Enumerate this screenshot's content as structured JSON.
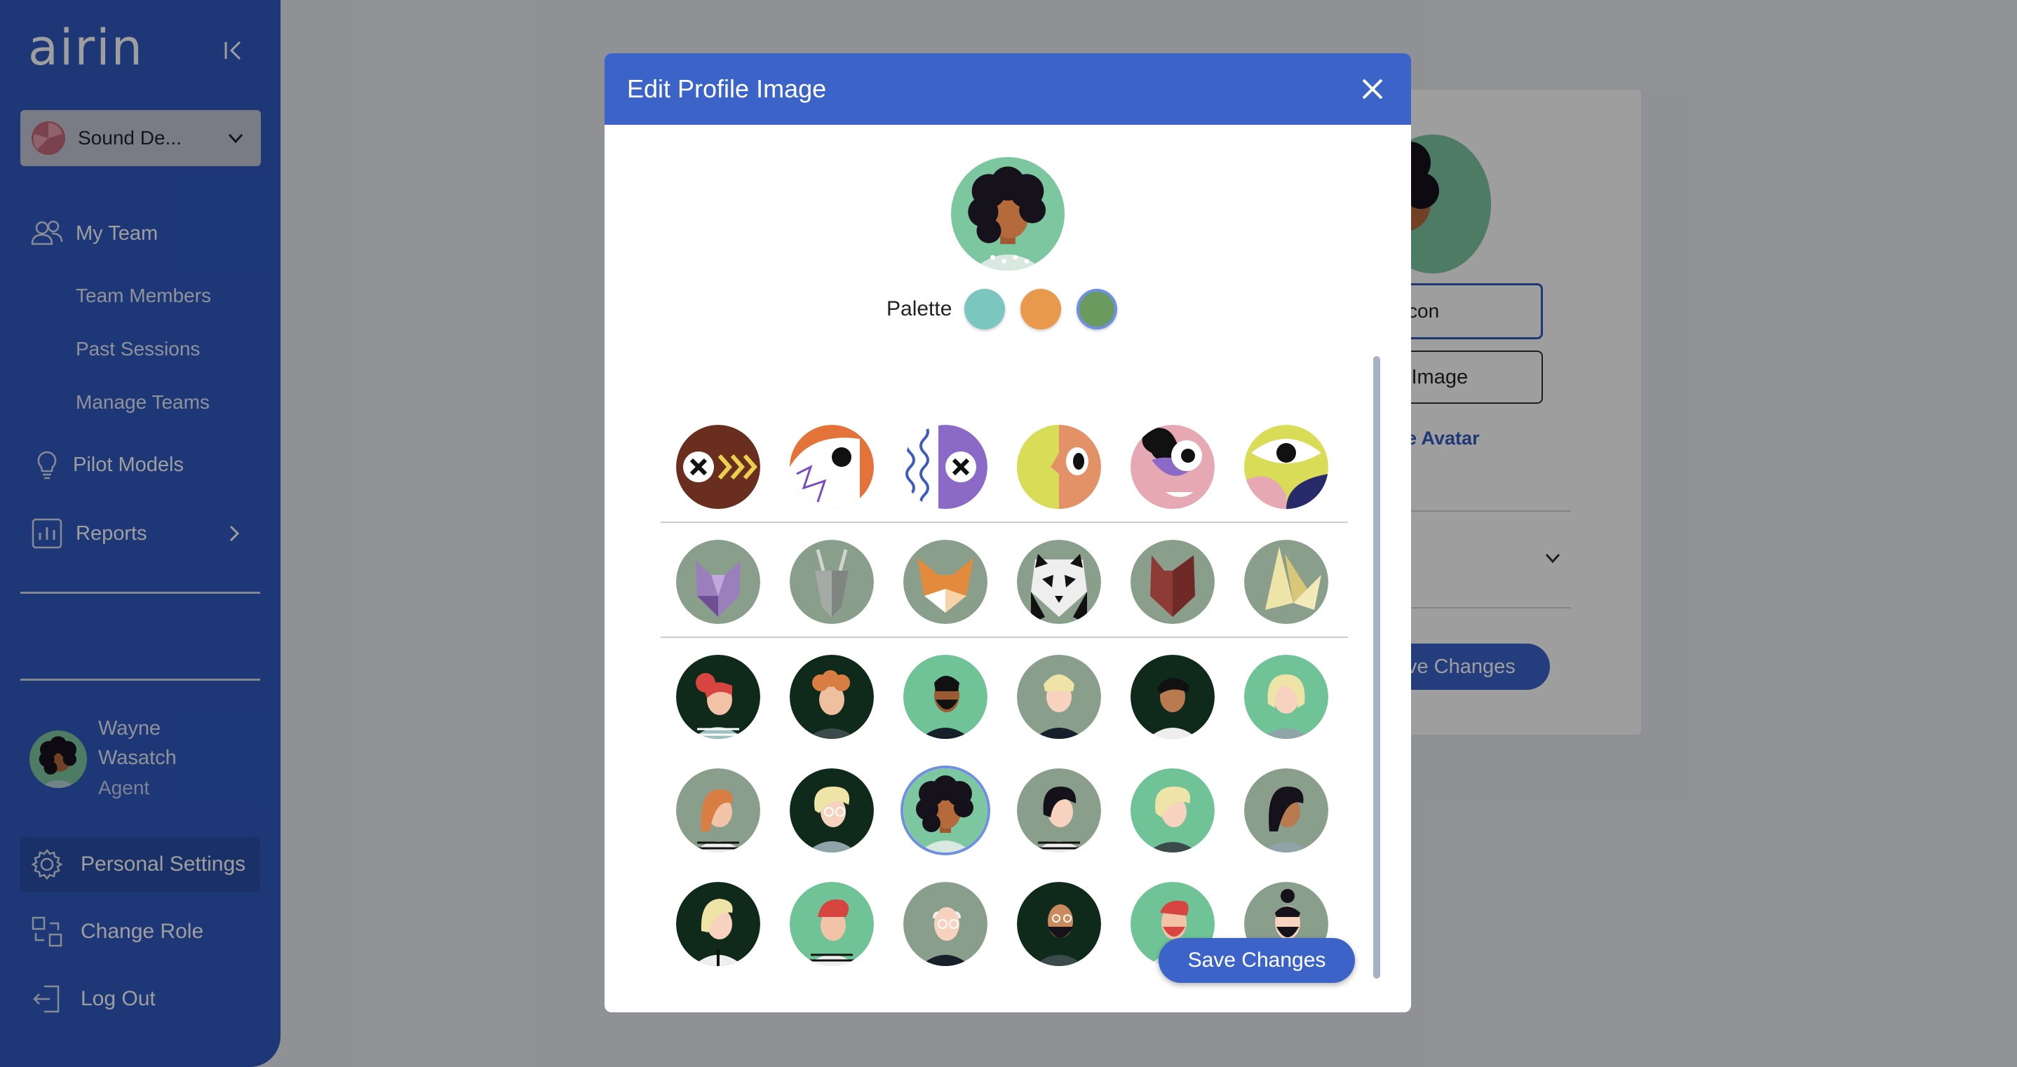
{
  "app": {
    "logo_text": "airin"
  },
  "sidebar": {
    "org_select": {
      "value": "Sound De..."
    },
    "items": [
      {
        "label": "My Team",
        "icon": "people-icon"
      },
      {
        "label": "Team Members"
      },
      {
        "label": "Past Sessions"
      },
      {
        "label": "Manage Teams"
      },
      {
        "label": "Pilot Models",
        "icon": "lightbulb-icon"
      },
      {
        "label": "Reports",
        "icon": "bar-chart-icon"
      }
    ],
    "user": {
      "name": "Wayne Wasatch",
      "role": "Agent"
    },
    "bottom": [
      {
        "label": "Personal Settings",
        "icon": "gear-icon",
        "active": true
      },
      {
        "label": "Change Role",
        "icon": "swap-icon"
      },
      {
        "label": "Log Out",
        "icon": "logout-icon"
      }
    ]
  },
  "background_page": {
    "input_value": "con",
    "upload_button": "l Image",
    "remove_link": "ve Avatar",
    "save_button": "ve Changes"
  },
  "modal": {
    "title": "Edit Profile Image",
    "palette_label": "Palette",
    "palette": [
      {
        "color": "#7cc6c0",
        "selected": false
      },
      {
        "color": "#e8994c",
        "selected": false
      },
      {
        "color": "#6b9a5e",
        "selected": true
      }
    ],
    "save_button": "Save Changes",
    "avatar_rows": [
      [
        "abstract-x-arrows",
        "abstract-eye-orange",
        "abstract-x-waves",
        "abstract-face-split",
        "abstract-eye-pink",
        "abstract-eye-yellow"
      ],
      [
        "animal-cat-purple",
        "animal-goat-gray",
        "animal-fox-orange",
        "animal-panda",
        "animal-cat-red",
        "animal-origami-yellow"
      ],
      [
        "person-redhair-bun",
        "person-curly-ginger",
        "person-beard-dark",
        "person-blonde-short",
        "person-dark-ponytail",
        "person-blonde-bob"
      ],
      [
        "person-ginger-long",
        "person-blonde-glasses",
        "person-afro-curly",
        "person-dark-bob",
        "person-blonde-wavy",
        "person-dark-long"
      ],
      [
        "person-blonde-tie",
        "person-red-quiff",
        "person-bald-glasses",
        "person-bald-beard",
        "person-red-beard",
        "person-topknot-beard"
      ]
    ],
    "selected_avatar": "person-afro-curly"
  }
}
